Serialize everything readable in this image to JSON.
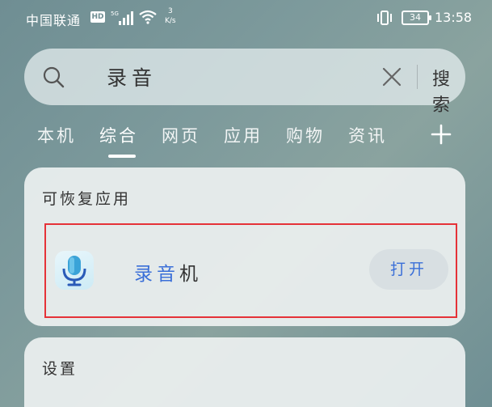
{
  "status_bar": {
    "carrier": "中国联通",
    "hd_badge": "HD",
    "network_type": "5G",
    "speed_value": "3",
    "speed_unit": "K/s",
    "battery": "34",
    "time": "13:58"
  },
  "search": {
    "query": "录音",
    "button_label": "搜索"
  },
  "tabs": [
    {
      "label": "本机",
      "active": false
    },
    {
      "label": "综合",
      "active": true
    },
    {
      "label": "网页",
      "active": false
    },
    {
      "label": "应用",
      "active": false
    },
    {
      "label": "购物",
      "active": false
    },
    {
      "label": "资讯",
      "active": false
    }
  ],
  "sections": {
    "recoverable_apps": {
      "title": "可恢复应用",
      "app": {
        "name_highlight": "录音",
        "name_rest": "机",
        "open_label": "打开"
      }
    },
    "settings": {
      "title": "设置"
    }
  },
  "colors": {
    "accent_blue": "#3a6fd8",
    "highlight_red": "#e53238"
  }
}
